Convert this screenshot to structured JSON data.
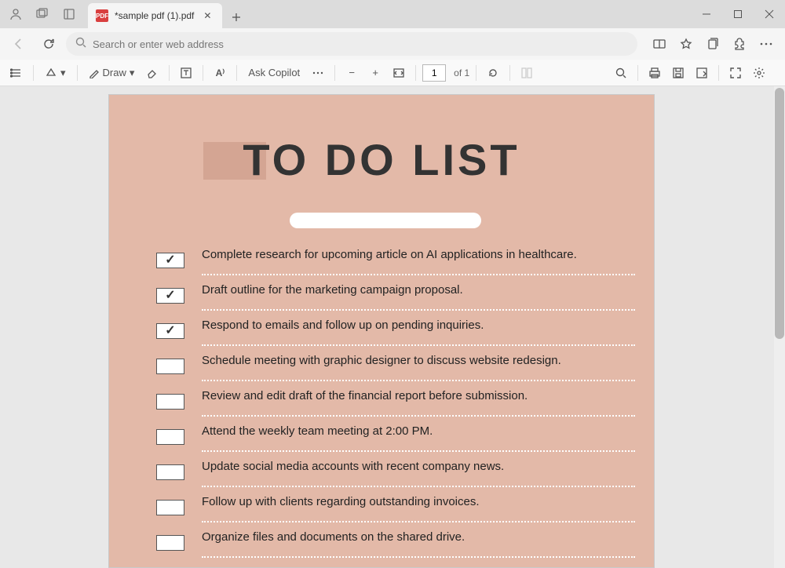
{
  "tab": {
    "title": "*sample pdf (1).pdf"
  },
  "omnibox": {
    "placeholder": "Search or enter web address"
  },
  "toolbar": {
    "draw_label": "Draw",
    "copilot_label": "Ask Copilot",
    "page_current": "1",
    "page_total": "of 1"
  },
  "doc": {
    "title": "TO DO LIST",
    "items": [
      {
        "checked": true,
        "text": "Complete research for upcoming article on AI applications in healthcare."
      },
      {
        "checked": true,
        "text": "Draft outline for the marketing campaign proposal."
      },
      {
        "checked": true,
        "text": "Respond to emails and follow up on pending inquiries."
      },
      {
        "checked": false,
        "text": "Schedule meeting with graphic designer to discuss website redesign."
      },
      {
        "checked": false,
        "text": "Review and edit draft of the financial report before submission."
      },
      {
        "checked": false,
        "text": "Attend the weekly team meeting at 2:00 PM."
      },
      {
        "checked": false,
        "text": "Update social media accounts with recent company news."
      },
      {
        "checked": false,
        "text": "Follow up with clients regarding outstanding invoices."
      },
      {
        "checked": false,
        "text": "Organize files and documents on the shared drive."
      }
    ]
  }
}
